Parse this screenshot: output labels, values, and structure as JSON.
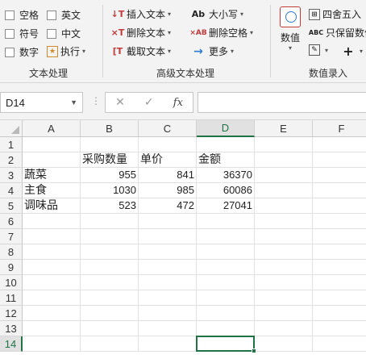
{
  "ribbon": {
    "text_group": {
      "label": "文本处理",
      "checkboxes": [
        "空格",
        "英文",
        "符号",
        "中文",
        "数字"
      ],
      "execute_label": "执行"
    },
    "advanced_group": {
      "label": "高级文本处理",
      "buttons": [
        "插入文本",
        "删除文本",
        "截取文本",
        "大小写",
        "删除空格",
        "更多"
      ]
    },
    "numeric_group": {
      "label": "数值录入",
      "numeric_label": "数值",
      "round_label": "四舍五入",
      "keep_label": "只保留数值"
    }
  },
  "formula_bar": {
    "name_box": "D14",
    "fx_label": "fx",
    "formula": ""
  },
  "sheet": {
    "columns": [
      "A",
      "B",
      "C",
      "D",
      "E",
      "F"
    ],
    "rows": [
      "1",
      "2",
      "3",
      "4",
      "5",
      "6",
      "7",
      "8",
      "9",
      "10",
      "11",
      "12",
      "13",
      "14"
    ],
    "cells": {
      "A3": "蔬菜",
      "A4": "主食",
      "A5": "调味品",
      "B2": "采购数量",
      "C2": "单价",
      "D2": "金额",
      "B3": "955",
      "C3": "841",
      "D3": "36370",
      "B4": "1030",
      "C4": "985",
      "D4": "60086",
      "B5": "523",
      "C5": "472",
      "D5": "27041"
    },
    "selected_cell": "D14"
  },
  "colors": {
    "accent": "#217346",
    "ribbon_bg": "#f3f3f3",
    "grid_line": "#e1e1e1"
  }
}
